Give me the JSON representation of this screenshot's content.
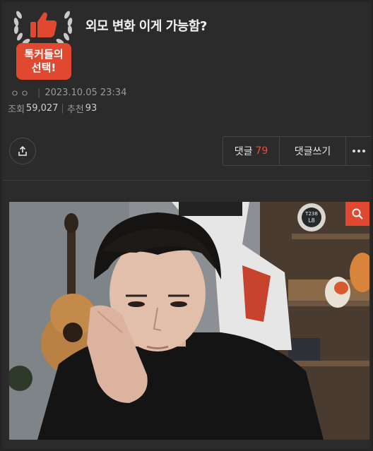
{
  "post": {
    "title": "외모 변화 이게 가능함?",
    "badge_line1": "톡커들의",
    "badge_line2": "선택!",
    "author": "ㅇㅇ",
    "datetime": "2023.10.05 23:34",
    "views_label": "조회",
    "views_value": "59,027",
    "recommend_label": "추천",
    "recommend_value": "93"
  },
  "actions": {
    "comments_label": "댓글",
    "comments_count": "79",
    "write_comment_label": "댓글쓰기"
  },
  "image": {
    "clock_line1": "T238",
    "clock_line2": "L8"
  },
  "icons": {
    "share": "share-icon",
    "more": "more-dots-icon",
    "zoom": "search-icon",
    "badge": "thumbs-up-laurel-icon"
  },
  "colors": {
    "accent": "#e0482f",
    "comment_count": "#ef4a3a",
    "background": "#2b2b2b"
  }
}
